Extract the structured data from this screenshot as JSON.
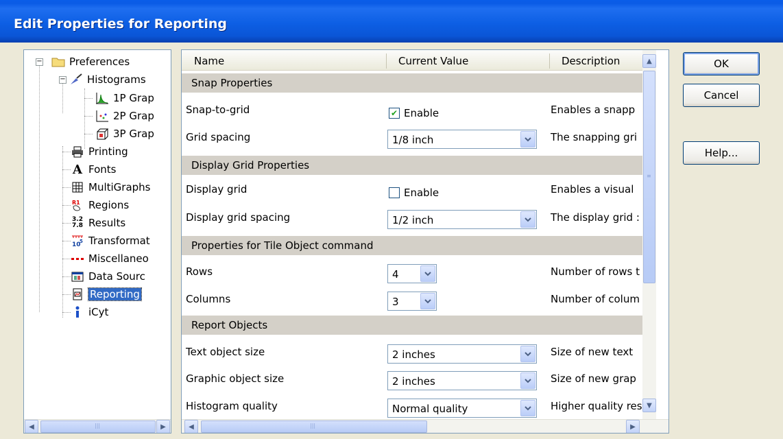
{
  "window": {
    "title": "Edit Properties for Reporting"
  },
  "tree": {
    "items": [
      {
        "label": "Preferences",
        "icon": "folder-icon"
      },
      {
        "label": "Histograms",
        "icon": "histogram-brush-icon"
      },
      {
        "label": "1P Grap",
        "icon": "1p-graph-icon"
      },
      {
        "label": "2P Grap",
        "icon": "2p-graph-icon"
      },
      {
        "label": "3P Grap",
        "icon": "3p-graph-icon"
      },
      {
        "label": "Printing",
        "icon": "printer-icon"
      },
      {
        "label": "Fonts",
        "icon": "font-icon"
      },
      {
        "label": "MultiGraphs",
        "icon": "multigraph-icon"
      },
      {
        "label": "Regions",
        "icon": "regions-icon"
      },
      {
        "label": "Results",
        "icon": "results-icon"
      },
      {
        "label": "Transformat",
        "icon": "transformation-icon"
      },
      {
        "label": "Miscellaneo",
        "icon": "miscellaneous-icon"
      },
      {
        "label": "Data Sourc",
        "icon": "data-source-icon"
      },
      {
        "label": "Reporting",
        "icon": "reporting-icon"
      },
      {
        "label": "iCyt",
        "icon": "info-icon"
      }
    ]
  },
  "grid": {
    "columns": {
      "name": "Name",
      "value": "Current Value",
      "description": "Description"
    },
    "sections": {
      "snap": "Snap Properties",
      "display": "Display Grid Properties",
      "tile": "Properties for Tile Object command",
      "report": "Report Objects"
    },
    "rows": {
      "snap_to_grid": {
        "name": "Snap-to-grid",
        "value": "Enable",
        "checked": true,
        "desc": "Enables a snapp"
      },
      "grid_spacing": {
        "name": "Grid spacing",
        "value": "1/8 inch",
        "desc": "The snapping gri"
      },
      "display_grid": {
        "name": "Display grid",
        "value": "Enable",
        "checked": false,
        "desc": "Enables a visual"
      },
      "display_grid_spacing": {
        "name": "Display grid spacing",
        "value": "1/2 inch",
        "desc": "The display grid :"
      },
      "rows": {
        "name": "Rows",
        "value": "4",
        "desc": "Number of rows t"
      },
      "columns": {
        "name": "Columns",
        "value": "3",
        "desc": "Number of colum"
      },
      "text_object_size": {
        "name": "Text object size",
        "value": "2 inches",
        "desc": "Size of new text"
      },
      "graphic_object_size": {
        "name": "Graphic object size",
        "value": "2 inches",
        "desc": "Size of new grap"
      },
      "histogram_quality": {
        "name": "Histogram quality",
        "value": "Normal quality",
        "desc": "Higher quality res"
      }
    }
  },
  "buttons": {
    "ok": "OK",
    "cancel": "Cancel",
    "help": "Help..."
  },
  "colors": {
    "title_bar": "#0a5de8",
    "dialog_bg": "#ece9d8",
    "selection": "#316ac5",
    "section_bg": "#d4d0c8"
  }
}
